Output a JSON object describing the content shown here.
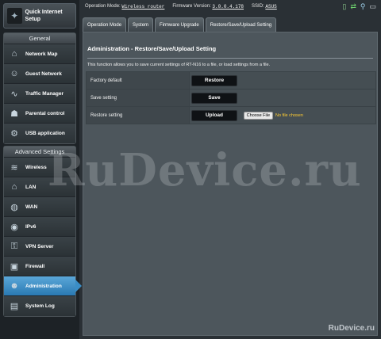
{
  "topbar": {
    "op_mode_label": "Operation Mode:",
    "op_mode_value": "Wireless router",
    "fw_label": "Firmware Version:",
    "fw_value": "3.0.0.4.178",
    "ssid_label": "SSID:",
    "ssid_value": "ASUS"
  },
  "sidebar": {
    "qis_label": "Quick Internet Setup",
    "general_title": "General",
    "general_items": [
      "Network Map",
      "Guest Network",
      "Traffic Manager",
      "Parental control",
      "USB application"
    ],
    "advanced_title": "Advanced Settings",
    "advanced_items": [
      "Wireless",
      "LAN",
      "WAN",
      "IPv6",
      "VPN Server",
      "Firewall",
      "Administration",
      "System Log"
    ]
  },
  "tabs": [
    "Operation Mode",
    "System",
    "Firmware Upgrade",
    "Restore/Save/Upload Setting"
  ],
  "panel": {
    "title": "Administration - Restore/Save/Upload Setting",
    "description": "This function allows you to save current settings of RT-N16 to a file, or load settings from a file.",
    "rows": [
      {
        "label": "Factory default",
        "button": "Restore"
      },
      {
        "label": "Save setting",
        "button": "Save"
      },
      {
        "label": "Restore setting",
        "button": "Upload"
      }
    ],
    "file_button": "Choose File",
    "file_status": "No file chosen"
  },
  "watermark": "RuDevice.ru",
  "watermark_small": "RuDevice.ru"
}
